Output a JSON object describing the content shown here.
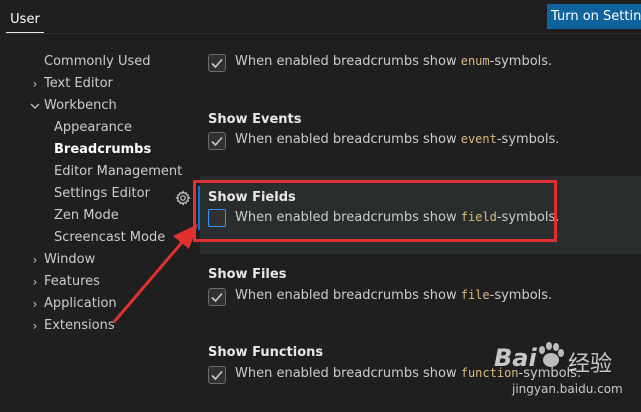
{
  "tabs": {
    "user_label": "User"
  },
  "sync_button": {
    "label": "Turn on Settings Sync"
  },
  "toc": {
    "items": [
      {
        "label": "Commonly Used",
        "expandable": false
      },
      {
        "label": "Text Editor",
        "expandable": true,
        "expanded": false
      },
      {
        "label": "Workbench",
        "expandable": true,
        "expanded": true
      },
      {
        "label": "Appearance",
        "indent": true
      },
      {
        "label": "Breadcrumbs",
        "indent": true,
        "selected": true
      },
      {
        "label": "Editor Management",
        "indent": true
      },
      {
        "label": "Settings Editor",
        "indent": true
      },
      {
        "label": "Zen Mode",
        "indent": true
      },
      {
        "label": "Screencast Mode",
        "indent": true
      },
      {
        "label": "Window",
        "expandable": true,
        "expanded": false
      },
      {
        "label": "Features",
        "expandable": true,
        "expanded": false
      },
      {
        "label": "Application",
        "expandable": true,
        "expanded": false
      },
      {
        "label": "Extensions",
        "expandable": true,
        "expanded": false
      }
    ]
  },
  "settings": [
    {
      "title": "",
      "desc_prefix": "When enabled breadcrumbs show ",
      "desc_code": "enum",
      "desc_suffix": "-symbols.",
      "checked": true
    },
    {
      "title": "Show Events",
      "desc_prefix": "When enabled breadcrumbs show ",
      "desc_code": "event",
      "desc_suffix": "-symbols.",
      "checked": true
    },
    {
      "title": "Show Fields",
      "desc_prefix": "When enabled breadcrumbs show ",
      "desc_code": "field",
      "desc_suffix": "-symbols.",
      "checked": false
    },
    {
      "title": "Show Files",
      "desc_prefix": "When enabled breadcrumbs show ",
      "desc_code": "file",
      "desc_suffix": "-symbols.",
      "checked": true
    },
    {
      "title": "Show Functions",
      "desc_prefix": "When enabled breadcrumbs show ",
      "desc_code": "function",
      "desc_suffix": "-symbols.",
      "checked": true
    }
  ],
  "icons": {
    "gear": "gear-icon",
    "chevron_right": "chevron-right-icon",
    "chevron_down": "chevron-down-icon",
    "check": "check-icon"
  },
  "annotation": {
    "box_color": "#e03030",
    "arrow_color": "#e03030"
  },
  "watermark": {
    "brand": "Bai",
    "brand2": "经验",
    "url": "jingyan.baidu.com"
  },
  "colors": {
    "accent": "#0e639c",
    "focus": "#0078d4",
    "code": "#d7ba7d"
  }
}
